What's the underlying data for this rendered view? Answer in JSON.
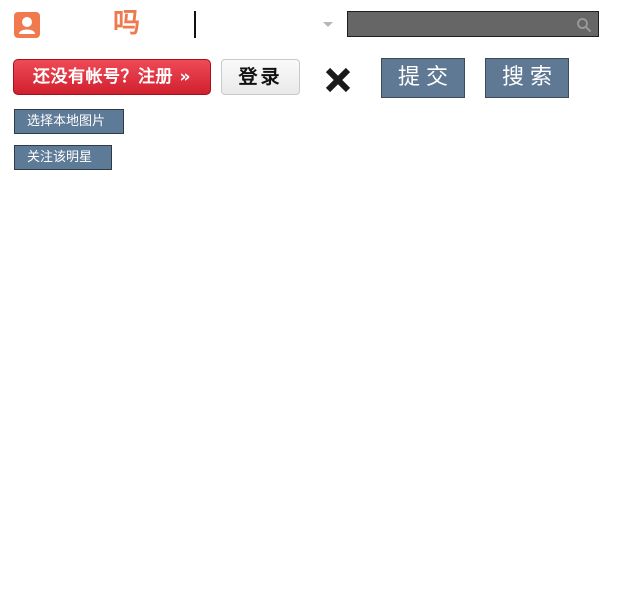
{
  "header": {
    "ma_char": "吗",
    "search": {
      "value": "",
      "placeholder": ""
    }
  },
  "auth": {
    "register_label": "还没有帐号？注册 »",
    "login_label": "登录"
  },
  "actions": {
    "submit_label": "提交",
    "search_label": "搜索"
  },
  "tools": {
    "pick_image_label": "选择本地图片",
    "follow_label": "关注该明星"
  },
  "colors": {
    "accent": "#ee7a4f",
    "register_red": "#d0202e",
    "button_slate": "#5f7894",
    "search_field": "#666666"
  }
}
